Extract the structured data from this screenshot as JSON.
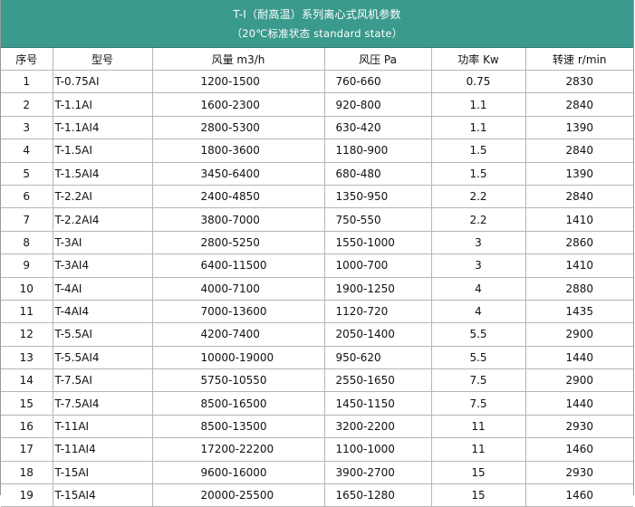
{
  "header": {
    "title": "T-I（耐高温）系列离心式风机参数",
    "subtitle": "（20℃标准状态 standard state）"
  },
  "table": {
    "columns": [
      "序号",
      "型号",
      "风量 m3/h",
      "风压 Pa",
      "功率 Kw",
      "转速 r/min"
    ],
    "rows": [
      [
        "1",
        "T-0.75AI",
        "1200-1500",
        "760-660",
        "0.75",
        "2830"
      ],
      [
        "2",
        "T-1.1AI",
        "1600-2300",
        "920-800",
        "1.1",
        "2840"
      ],
      [
        "3",
        "T-1.1AI4",
        "2800-5300",
        "630-420",
        "1.1",
        "1390"
      ],
      [
        "4",
        "T-1.5AI",
        "1800-3600",
        "1180-900",
        "1.5",
        "2840"
      ],
      [
        "5",
        "T-1.5AI4",
        "3450-6400",
        "680-480",
        "1.5",
        "1390"
      ],
      [
        "6",
        "T-2.2AI",
        "2400-4850",
        "1350-950",
        "2.2",
        "2840"
      ],
      [
        "7",
        "T-2.2AI4",
        "3800-7000",
        "750-550",
        "2.2",
        "1410"
      ],
      [
        "8",
        "T-3AI",
        "2800-5250",
        "1550-1000",
        "3",
        "2860"
      ],
      [
        "9",
        "T-3AI4",
        "6400-11500",
        "1000-700",
        "3",
        "1410"
      ],
      [
        "10",
        "T-4AI",
        "4000-7100",
        "1900-1250",
        "4",
        "2880"
      ],
      [
        "11",
        "T-4AI4",
        "7000-13600",
        "1120-720",
        "4",
        "1435"
      ],
      [
        "12",
        "T-5.5AI",
        "4200-7400",
        "2050-1400",
        "5.5",
        "2900"
      ],
      [
        "13",
        "T-5.5AI4",
        "10000-19000",
        "950-620",
        "5.5",
        "1440"
      ],
      [
        "14",
        "T-7.5AI",
        "5750-10550",
        "2550-1650",
        "7.5",
        "2900"
      ],
      [
        "15",
        "T-7.5AI4",
        "8500-16500",
        "1450-1150",
        "7.5",
        "1440"
      ],
      [
        "16",
        "T-11AI",
        "8500-13500",
        "3200-2200",
        "11",
        "2930"
      ],
      [
        "17",
        "T-11AI4",
        "17200-22200",
        "1100-1000",
        "11",
        "1460"
      ],
      [
        "18",
        "T-15AI",
        "9600-16000",
        "3900-2700",
        "15",
        "2930"
      ],
      [
        "19",
        "T-15AI4",
        "20000-25500",
        "1650-1280",
        "15",
        "1460"
      ]
    ]
  },
  "colors": {
    "header_background": "#3a9a8c",
    "header_text": "#ffffff",
    "grid_line": "#b5b5b5"
  }
}
